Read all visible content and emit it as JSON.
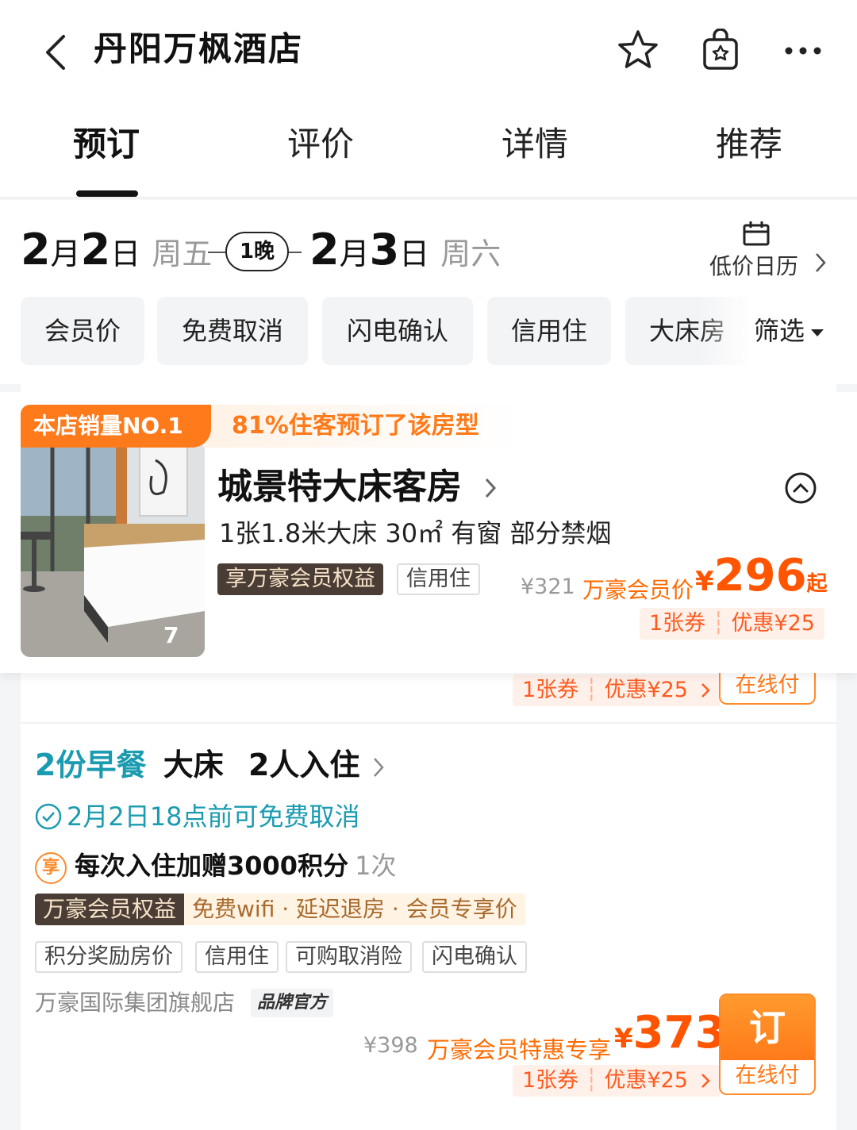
{
  "header": {
    "title": "丹阳万枫酒店",
    "icons": [
      "back-arrow-icon",
      "star-icon",
      "bag-icon",
      "more-icon"
    ]
  },
  "tabs": [
    {
      "label": "预订",
      "active": true
    },
    {
      "label": "评价",
      "active": false
    },
    {
      "label": "详情",
      "active": false
    },
    {
      "label": "推荐",
      "active": false
    }
  ],
  "dates": {
    "checkin_month": "2",
    "checkin_day": "2",
    "checkin_weekday": "周五",
    "nights": "1晚",
    "checkout_month": "2",
    "checkout_day": "3",
    "checkout_weekday": "周六",
    "month_char": "月",
    "day_char": "日",
    "calendar_label": "低价日历"
  },
  "chips": [
    "会员价",
    "免费取消",
    "闪电确认",
    "信用住",
    "大床房"
  ],
  "filter_label": "筛选",
  "room": {
    "badge_no1": "本店销量NO.1",
    "badge_pct": "81%住客预订了该房型",
    "name": "城景特大床客房",
    "specs": "1张1.8米大床  30㎡  有窗  部分禁烟",
    "tag_member": "享万豪会员权益",
    "tag_credit": "信用住",
    "photo_count": "7",
    "orig_price": "¥321",
    "member_label": "万豪会员价",
    "price_yen": "¥",
    "price": "296",
    "price_suffix": "起",
    "coupon_count": "1张券",
    "coupon_discount": "优惠¥25"
  },
  "prev_offer": {
    "coupon_count": "1张券",
    "coupon_discount": "优惠¥25",
    "pay_label": "在线付"
  },
  "offer": {
    "meal": "2份早餐",
    "bed": "大床",
    "guests": "2人入住",
    "cancel": "2月2日18点前可免费取消",
    "xiang": "享",
    "points": "每次入住加赠3000积分",
    "times": "1次",
    "benefit_dark": "万豪会员权益",
    "benefit_light": "免费wifi · 延迟退房 · 会员专享价",
    "tags": [
      "积分奖励房价",
      "信用住",
      "可购取消险",
      "闪电确认"
    ],
    "shop": "万豪国际集团旗舰店",
    "official": "品牌官方",
    "orig_price": "¥398",
    "member_label": "万豪会员特惠专享",
    "price_yen": "¥",
    "price": "373",
    "coupon_count": "1张券",
    "coupon_discount": "优惠¥25",
    "book_label": "订",
    "pay_label": "在线付"
  },
  "colors": {
    "accent_orange": "#ff5500",
    "teal": "#1a9bb0",
    "member_dark": "#4a3d35"
  }
}
